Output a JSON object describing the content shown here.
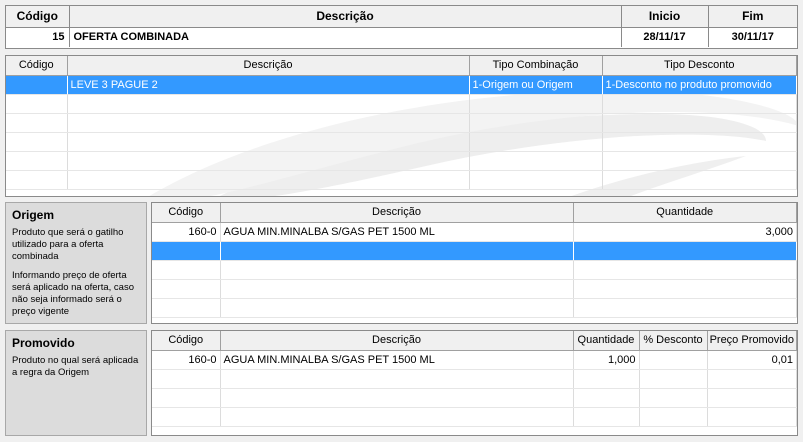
{
  "header": {
    "columns": [
      "Código",
      "Descrição",
      "Inicio",
      "Fim"
    ],
    "codigo": "15",
    "descricao": "OFERTA COMBINADA",
    "inicio": "28/11/17",
    "fim": "30/11/17"
  },
  "combinacao": {
    "columns": [
      "Código",
      "Descrição",
      "Tipo Combinação",
      "Tipo Desconto"
    ],
    "rows": [
      {
        "codigo": "",
        "descricao": "LEVE 3 PAGUE 2",
        "tipo_combinacao": "1-Origem ou Origem",
        "tipo_desconto": "1-Desconto no produto promovido"
      }
    ]
  },
  "origem": {
    "title": "Origem",
    "help1": "Produto que será o gatilho utilizado para a oferta combinada",
    "help2": "Informando preço de oferta será aplicado na oferta, caso não seja informado será o preço vigente",
    "columns": [
      "Código",
      "Descrição",
      "Quantidade"
    ],
    "rows": [
      {
        "codigo": "160-0",
        "descricao": "AGUA MIN.MINALBA S/GAS PET 1500 ML",
        "quantidade": "3,000"
      }
    ]
  },
  "promovido": {
    "title": "Promovido",
    "help1": "Produto no qual será aplicada a regra da Origem",
    "columns": [
      "Código",
      "Descrição",
      "Quantidade",
      "% Desconto",
      "Preço Promovido"
    ],
    "rows": [
      {
        "codigo": "160-0",
        "descricao": "AGUA MIN.MINALBA S/GAS PET 1500 ML",
        "quantidade": "1,000",
        "desconto": "",
        "preco": "0,01"
      }
    ]
  },
  "colors": {
    "selection": "#3399ff",
    "panel": "#dcdcdc",
    "window": "#f0f0f0"
  }
}
